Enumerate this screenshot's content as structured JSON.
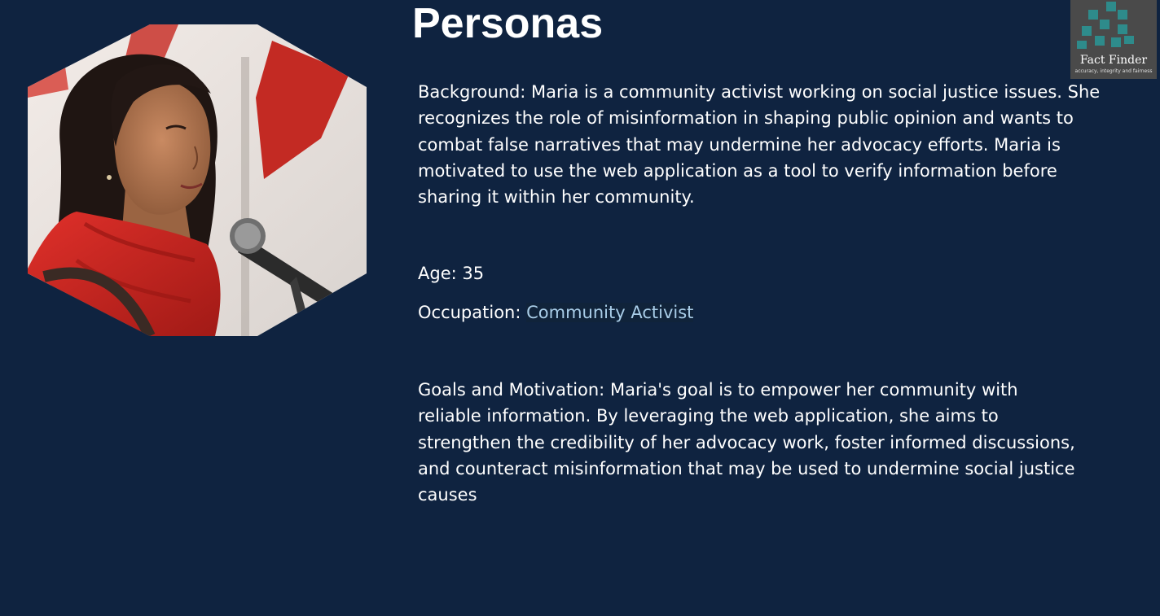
{
  "slide": {
    "title": "Personas",
    "background_color": "#0f2340",
    "link_color": "#a9cde8"
  },
  "portrait": {
    "icon": "persona-photo-woman-speaking-at-microphone"
  },
  "logo": {
    "icon": "fact-finder-logo-icon",
    "name": "Fact Finder",
    "tagline": "accuracy, integrity and fairness",
    "mark_color": "#2e8b8b"
  },
  "persona": {
    "background_label": "Background:",
    "background_text": "Maria is a community activist working on social justice issues. She recognizes the role of misinformation in shaping public opinion and wants to combat false narratives that may undermine her advocacy efforts. Maria is motivated to use the web application as a tool to verify information before sharing it within her community.",
    "age_label": "Age:",
    "age_value": "35",
    "occupation_label": "Occupation:",
    "occupation_value": "Community Activist",
    "goals_label": "Goals and Motivation:",
    "goals_text": "Maria's goal is to empower her community with reliable information. By leveraging the web application, she aims to strengthen the credibility of her advocacy work, foster informed discussions, and counteract misinformation that may be used to undermine social justice causes"
  }
}
